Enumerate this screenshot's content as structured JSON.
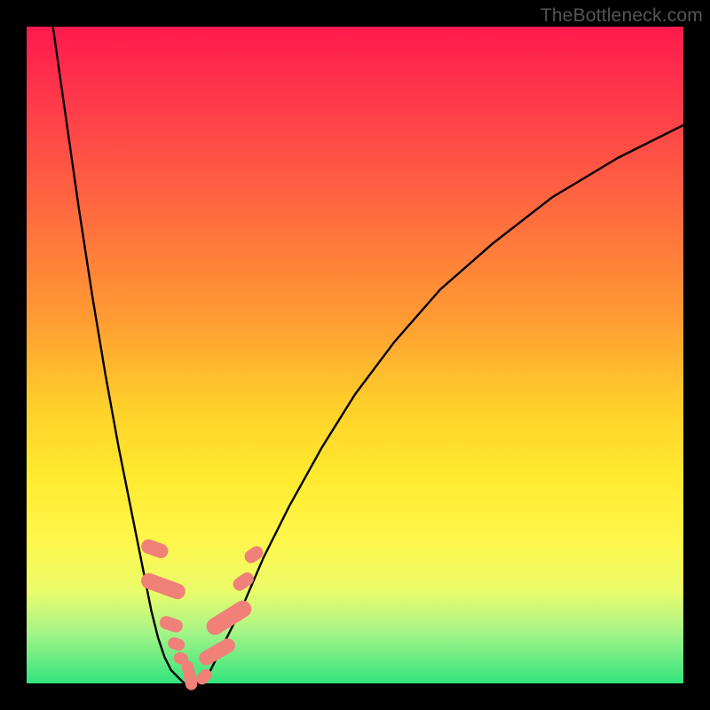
{
  "watermark": {
    "text": "TheBottleneck.com"
  },
  "chart_data": {
    "type": "line",
    "title": "",
    "xlabel": "",
    "ylabel": "",
    "xlim": [
      0,
      100
    ],
    "ylim": [
      0,
      100
    ],
    "grid": false,
    "legend": false,
    "series": [
      {
        "name": "curve-left",
        "color": "#000000",
        "x": [
          4,
          6,
          8,
          10,
          12,
          14,
          16,
          18,
          19,
          20,
          21,
          22,
          23,
          24
        ],
        "y": [
          100,
          86,
          72,
          59,
          47,
          36,
          26,
          16,
          11,
          7,
          4,
          2,
          1,
          0
        ]
      },
      {
        "name": "curve-right",
        "color": "#000000",
        "x": [
          26,
          28,
          30,
          33,
          36,
          40,
          45,
          50,
          56,
          63,
          71,
          80,
          90,
          100
        ],
        "y": [
          0,
          2,
          6,
          12,
          19,
          27,
          36,
          44,
          52,
          60,
          67,
          74,
          80,
          85
        ]
      },
      {
        "name": "scatter-salmon",
        "color": "#f08078",
        "marker": "rounded-rect",
        "points": [
          {
            "x": 19.5,
            "y": 20.5,
            "w": 2.2,
            "h": 4.2,
            "rot": -70
          },
          {
            "x": 20.8,
            "y": 14.8,
            "w": 2.4,
            "h": 7.0,
            "rot": -70
          },
          {
            "x": 22.0,
            "y": 9.0,
            "w": 2.0,
            "h": 3.6,
            "rot": -72
          },
          {
            "x": 22.8,
            "y": 6.0,
            "w": 1.8,
            "h": 2.6,
            "rot": -72
          },
          {
            "x": 23.5,
            "y": 3.8,
            "w": 1.8,
            "h": 2.2,
            "rot": -74
          },
          {
            "x": 24.8,
            "y": 1.2,
            "w": 1.8,
            "h": 4.5,
            "rot": -12
          },
          {
            "x": 27.0,
            "y": 1.0,
            "w": 1.8,
            "h": 2.6,
            "rot": 45
          },
          {
            "x": 29.0,
            "y": 4.8,
            "w": 2.2,
            "h": 6.0,
            "rot": 60
          },
          {
            "x": 30.8,
            "y": 10.0,
            "w": 2.6,
            "h": 7.6,
            "rot": 58
          },
          {
            "x": 33.0,
            "y": 15.5,
            "w": 2.0,
            "h": 3.4,
            "rot": 55
          },
          {
            "x": 34.6,
            "y": 19.6,
            "w": 2.0,
            "h": 3.0,
            "rot": 55
          }
        ]
      }
    ],
    "background_gradient": {
      "stops": [
        {
          "pos": 0,
          "color": "#ff1a4d"
        },
        {
          "pos": 28,
          "color": "#ff6a3f"
        },
        {
          "pos": 58,
          "color": "#ffd02a"
        },
        {
          "pos": 78,
          "color": "#fff64a"
        },
        {
          "pos": 100,
          "color": "#32e47f"
        }
      ]
    }
  }
}
